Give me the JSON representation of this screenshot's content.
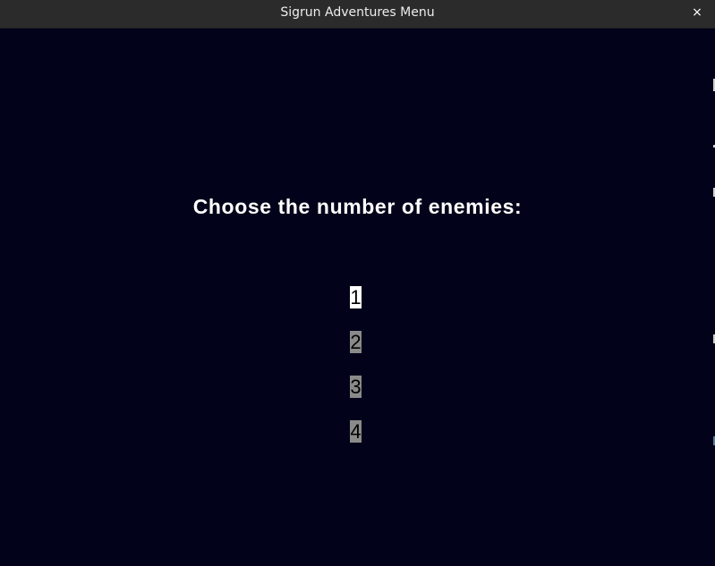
{
  "window": {
    "title": "Sigrun Adventures Menu",
    "close_glyph": "×"
  },
  "menu": {
    "heading": "Choose the number of enemies:",
    "options": [
      "1",
      "2",
      "3",
      "4"
    ],
    "selected_option": "1"
  },
  "colors": {
    "background": "#02021a",
    "titlebar": "#2b2b2b",
    "selected_highlight": "#ffffff",
    "unselected_highlight": "#8a8a8a"
  }
}
